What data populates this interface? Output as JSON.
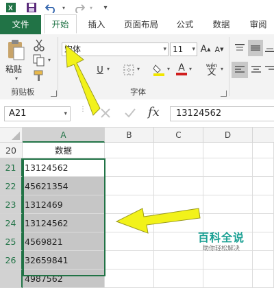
{
  "quick_access": {
    "icons": [
      "excel-app-icon",
      "save-icon",
      "undo-icon",
      "redo-icon"
    ]
  },
  "tabs": [
    {
      "label": "文件"
    },
    {
      "label": "开始"
    },
    {
      "label": "插入"
    },
    {
      "label": "页面布局"
    },
    {
      "label": "公式"
    },
    {
      "label": "数据"
    },
    {
      "label": "审阅"
    }
  ],
  "ribbon": {
    "clipboard": {
      "group_label": "剪贴板",
      "paste_label": "粘贴"
    },
    "font": {
      "group_label": "字体",
      "font_name": "宋体",
      "font_size": "11",
      "underline_label": "U",
      "grow_label": "A",
      "shrink_label": "A",
      "phonetic_label": "wén",
      "phonetic_char": "文",
      "font_color_label": "A"
    }
  },
  "formula_bar": {
    "name_box": "A21",
    "fx_label": "fx",
    "value": "13124562"
  },
  "grid": {
    "columns": [
      "A",
      "B",
      "C",
      "D"
    ],
    "rows": [
      "20",
      "21",
      "22",
      "23",
      "24",
      "25",
      "26"
    ],
    "cells_a": [
      "数据",
      "13124562",
      "45621354",
      "1312469",
      "13124562",
      "4569821",
      "32659841",
      "4987562"
    ]
  },
  "watermark": {
    "title": "百科全说",
    "subtitle": "助你轻松解决"
  },
  "colors": {
    "accent": "#217346",
    "arrow": "#f2f21a",
    "watermark": "#1aa093"
  }
}
